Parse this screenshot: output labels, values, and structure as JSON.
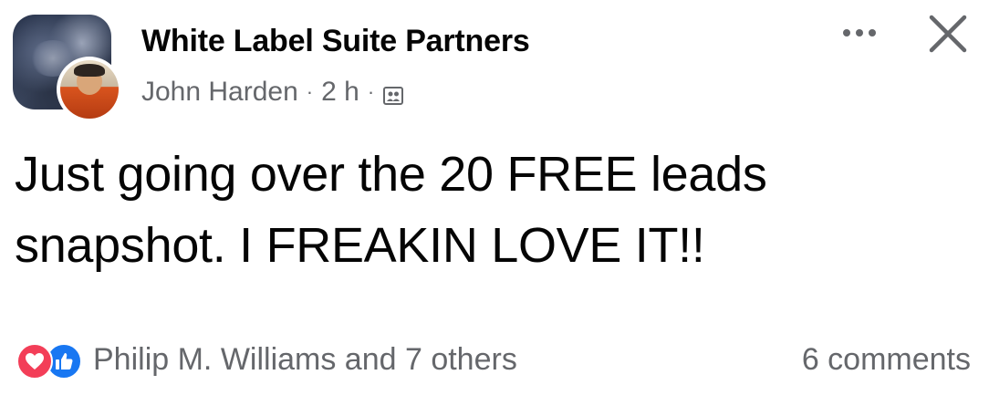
{
  "post": {
    "group_name": "White Label Suite Partners",
    "author": "John Harden",
    "time": "2 h",
    "separator": "·",
    "audience_icon": "group-members-icon",
    "more_icon": "more-options-icon",
    "close_icon": "close-icon",
    "text_lines": [
      "Just going over the 20 FREE leads",
      "snapshot. I FREAKIN LOVE IT!!"
    ],
    "reactions": {
      "icons": [
        "love-reaction-icon",
        "like-reaction-icon"
      ],
      "summary": "Philip M. Williams and 7 others"
    },
    "comments": "6 comments"
  },
  "colors": {
    "text_primary": "#050505",
    "text_secondary": "#65676b",
    "love": "#f33e58",
    "like": "#1877f2",
    "background": "#ffffff"
  }
}
